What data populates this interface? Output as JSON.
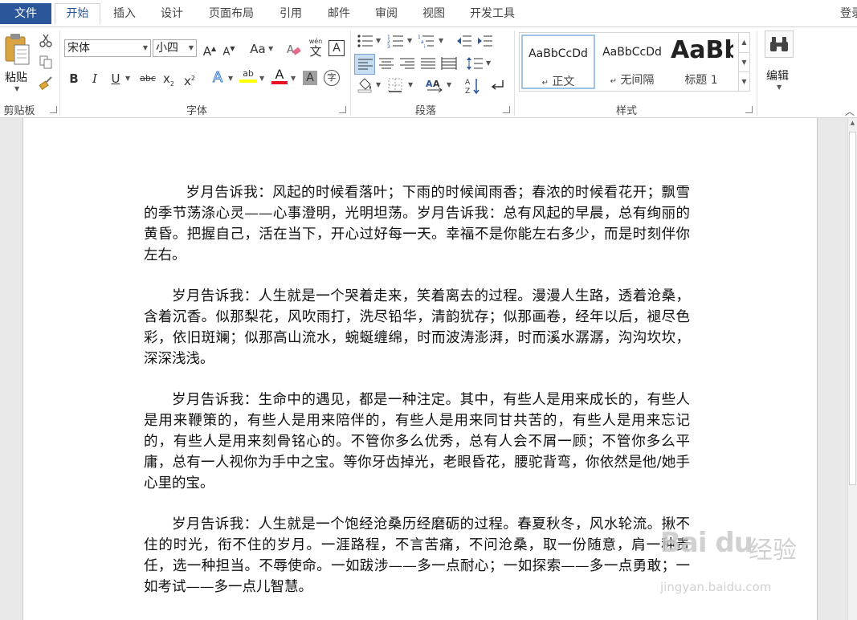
{
  "tabs": {
    "file": "文件",
    "items": [
      "开始",
      "插入",
      "设计",
      "页面布局",
      "引用",
      "邮件",
      "审阅",
      "视图",
      "开发工具"
    ],
    "login": "登录"
  },
  "clipboard": {
    "paste_label": "粘贴",
    "group_label": "剪贴板"
  },
  "font": {
    "name": "宋体",
    "size": "小四",
    "group_label": "字体",
    "grow": "A",
    "shrink": "A",
    "case": "Aa",
    "bold": "B",
    "italic": "I",
    "underline": "U",
    "strike": "abc",
    "subscript": "x",
    "superscript": "x",
    "effects": "A",
    "highlight": "ab",
    "color": "A",
    "shading": "A",
    "phonetic": "wén",
    "phonetic_char": "文",
    "border": "A",
    "enclose": "字"
  },
  "paragraph": {
    "group_label": "段落"
  },
  "styles": {
    "group_label": "样式",
    "items": [
      {
        "sample": "AaBbCcDd",
        "name": "正文",
        "mark": "↵"
      },
      {
        "sample": "AaBbCcDd",
        "name": "无间隔",
        "mark": "↵"
      },
      {
        "sample": "AaBb",
        "name": "标题 1",
        "mark": ""
      }
    ]
  },
  "editing": {
    "label": "编辑"
  },
  "document": {
    "paragraphs": [
      "岁月告诉我：风起的时候看落叶；下雨的时候闻雨香；春浓的时候看花开；飘雪的季节荡涤心灵——心事澄明，光明坦荡。岁月告诉我：总有风起的早晨，总有绚丽的黄昏。把握自己，活在当下，开心过好每一天。幸福不是你能左右多少，而是时刻伴你左右。",
      "岁月告诉我：人生就是一个哭着走来，笑着离去的过程。漫漫人生路，透着沧桑，含着沉香。似那梨花，风吹雨打，洗尽铅华，清韵犹存；似那画卷，经年以后，褪尽色彩，依旧斑斓；似那高山流水，蜿蜒缠绵，时而波涛澎湃，时而溪水潺潺，沟沟坎坎，深深浅浅。",
      "岁月告诉我：生命中的遇见，都是一种注定。其中，有些人是用来成长的，有些人是用来鞭策的，有些人是用来陪伴的，有些人是用来同甘共苦的，有些人是用来忘记的，有些人是用来刻骨铭心的。不管你多么优秀，总有人会不屑一顾；不管你多么平庸，总有一人视你为手中之宝。等你牙齿掉光，老眼昏花，腰驼背弯，你依然是他/她手心里的宝。",
      "岁月告诉我：人生就是一个饱经沧桑历经磨砺的过程。春夏秋冬，风水轮流。揪不住的时光，衔不住的岁月。一涯路程，不言苦痛，不问沧桑，取一份随意，肩一种责任，选一种担当。不辱使命。一如跋涉——多一点耐心；一如探索——多一点勇敢；一如考试——多一点儿智慧。"
    ]
  },
  "watermark": {
    "logo": "Bai du",
    "cn": "经验",
    "url": "jingyan.baidu.com"
  },
  "colors": {
    "file_tab": "#2b579a",
    "highlight": "#ffff00",
    "font_color": "#e81123"
  }
}
